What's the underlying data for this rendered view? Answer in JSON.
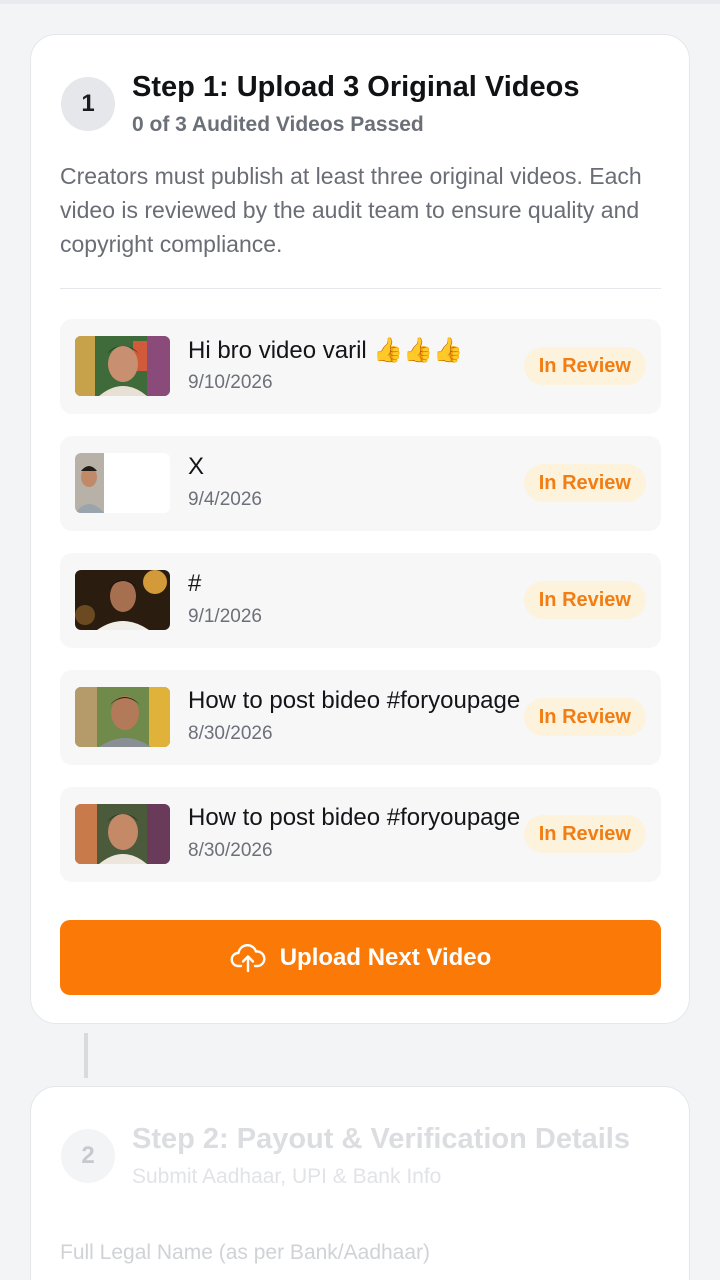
{
  "step1": {
    "number": "1",
    "title": "Step 1: Upload 3 Original Videos",
    "subtitle": "0 of 3 Audited Videos Passed",
    "description": "Creators must publish at least three original videos. Each video is reviewed by the audit team to ensure quality and copyright compliance.",
    "videos": [
      {
        "title": "Hi bro video varil 👍👍👍",
        "date": "9/10/2026",
        "status": "In Review"
      },
      {
        "title": "X",
        "date": "9/4/2026",
        "status": "In Review"
      },
      {
        "title": "#",
        "date": "9/1/2026",
        "status": "In Review"
      },
      {
        "title": "How to post bideo #foryoupage",
        "date": "8/30/2026",
        "status": "In Review"
      },
      {
        "title": "How to post bideo #foryoupage",
        "date": "8/30/2026",
        "status": "In Review"
      }
    ],
    "upload_button_label": "Upload Next Video",
    "upload_icon": "cloud-upload-icon"
  },
  "step2": {
    "number": "2",
    "title": "Step 2: Payout & Verification Details",
    "subtitle": "Submit Aadhaar, UPI & Bank Info",
    "field_label": "Full Legal Name (as per Bank/Aadhaar)"
  },
  "colors": {
    "accent": "#fb7a07",
    "badge_bg": "#fdf2dc",
    "badge_text": "#f27d12"
  }
}
